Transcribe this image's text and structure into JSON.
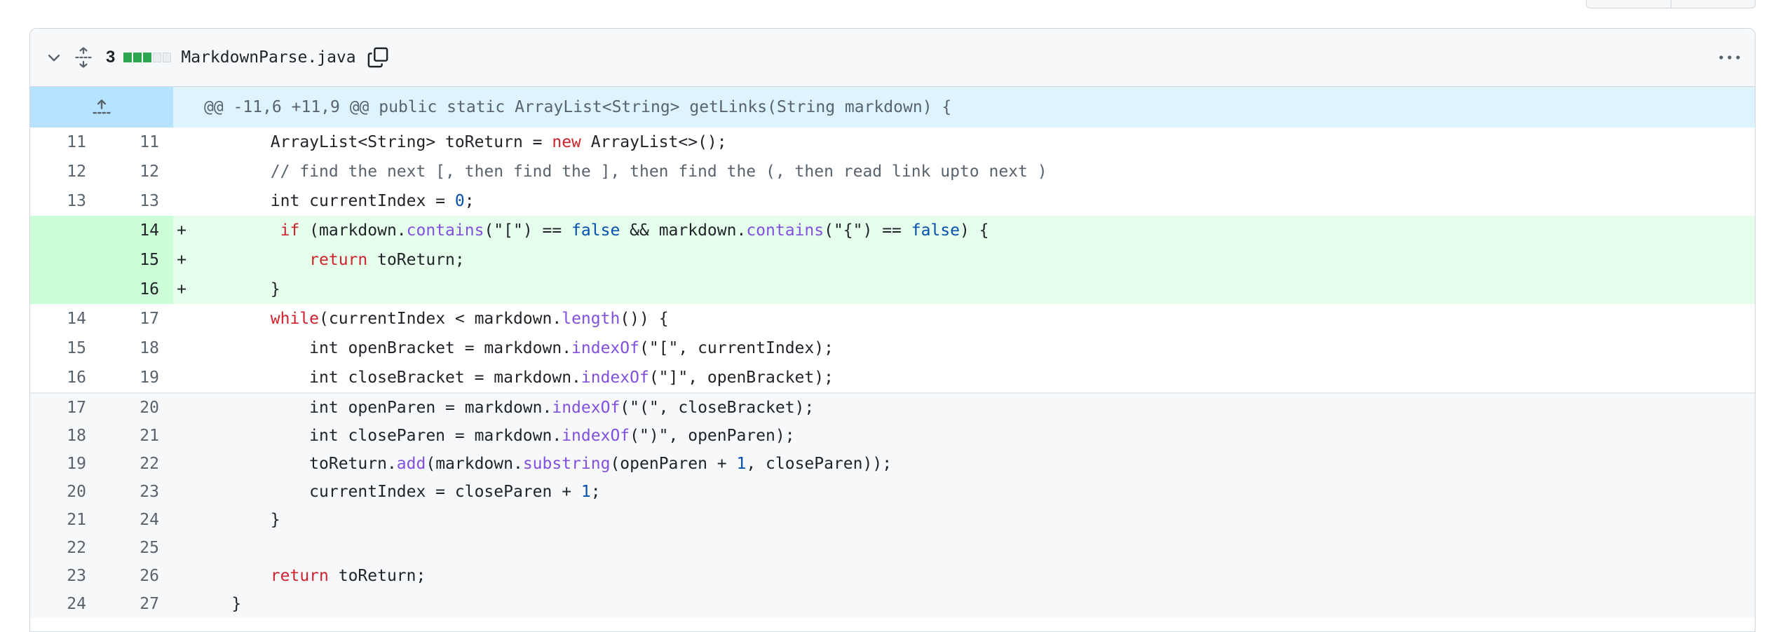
{
  "file": {
    "changes_count": "3",
    "filename": "MarkdownParse.java",
    "diffstat": [
      "add",
      "add",
      "add",
      "neutral",
      "neutral"
    ],
    "colors": {
      "add": "#2da44e",
      "neutral": "#eaeef2"
    }
  },
  "hunk": {
    "header": "@@ -11,6 +11,9 @@ public static ArrayList<String> getLinks(String markdown) {"
  },
  "lines": [
    {
      "old": "11",
      "new": "11",
      "type": "context",
      "tokens": [
        [
          "",
          "        ArrayList<String> toReturn = "
        ],
        [
          "kw",
          "new"
        ],
        [
          "",
          " ArrayList<>();"
        ]
      ]
    },
    {
      "old": "12",
      "new": "12",
      "type": "context",
      "tokens": [
        [
          "cm",
          "        // find the next [, then find the ], then find the (, then read link upto next )"
        ]
      ]
    },
    {
      "old": "13",
      "new": "13",
      "type": "context",
      "tokens": [
        [
          "",
          "        int currentIndex = "
        ],
        [
          "cst",
          "0"
        ],
        [
          "",
          ";"
        ]
      ]
    },
    {
      "old": "",
      "new": "14",
      "type": "add",
      "tokens": [
        [
          "",
          "         "
        ],
        [
          "kw",
          "if"
        ],
        [
          "",
          " (markdown."
        ],
        [
          "fn",
          "contains"
        ],
        [
          "",
          "(\"[\") == "
        ],
        [
          "cst",
          "false"
        ],
        [
          "",
          " && markdown."
        ],
        [
          "fn",
          "contains"
        ],
        [
          "",
          "(\"{\") == "
        ],
        [
          "cst",
          "false"
        ],
        [
          "",
          ") {"
        ]
      ]
    },
    {
      "old": "",
      "new": "15",
      "type": "add",
      "tokens": [
        [
          "",
          "            "
        ],
        [
          "kw",
          "return"
        ],
        [
          "",
          " toReturn;"
        ]
      ]
    },
    {
      "old": "",
      "new": "16",
      "type": "add",
      "tokens": [
        [
          "",
          "        }"
        ]
      ]
    },
    {
      "old": "14",
      "new": "17",
      "type": "context",
      "tokens": [
        [
          "",
          "        "
        ],
        [
          "kw",
          "while"
        ],
        [
          "",
          "(currentIndex < markdown."
        ],
        [
          "fn",
          "length"
        ],
        [
          "",
          "()) {"
        ]
      ]
    },
    {
      "old": "15",
      "new": "18",
      "type": "context",
      "tokens": [
        [
          "",
          "            int openBracket = markdown."
        ],
        [
          "fn",
          "indexOf"
        ],
        [
          "",
          "(\"[\", currentIndex);"
        ]
      ]
    },
    {
      "old": "16",
      "new": "19",
      "type": "context",
      "tokens": [
        [
          "",
          "            int closeBracket = markdown."
        ],
        [
          "fn",
          "indexOf"
        ],
        [
          "",
          "(\"]\", openBracket);"
        ]
      ]
    }
  ],
  "gray_lines": [
    {
      "old": "17",
      "new": "20",
      "tokens": [
        [
          "",
          "            int openParen = markdown."
        ],
        [
          "fn",
          "indexOf"
        ],
        [
          "",
          "(\"(\", closeBracket);"
        ]
      ]
    },
    {
      "old": "18",
      "new": "21",
      "tokens": [
        [
          "",
          "            int closeParen = markdown."
        ],
        [
          "fn",
          "indexOf"
        ],
        [
          "",
          "(\")\", openParen);"
        ]
      ]
    },
    {
      "old": "19",
      "new": "22",
      "tokens": [
        [
          "",
          "            toReturn."
        ],
        [
          "fn",
          "add"
        ],
        [
          "",
          "(markdown."
        ],
        [
          "fn",
          "substring"
        ],
        [
          "",
          "(openParen + "
        ],
        [
          "cst",
          "1"
        ],
        [
          "",
          ", closeParen));"
        ]
      ]
    },
    {
      "old": "20",
      "new": "23",
      "tokens": [
        [
          "",
          "            currentIndex = closeParen + "
        ],
        [
          "cst",
          "1"
        ],
        [
          "",
          ";"
        ]
      ]
    },
    {
      "old": "21",
      "new": "24",
      "tokens": [
        [
          "",
          "        }"
        ]
      ]
    },
    {
      "old": "22",
      "new": "25",
      "tokens": [
        [
          "",
          ""
        ]
      ]
    },
    {
      "old": "23",
      "new": "26",
      "tokens": [
        [
          "",
          "        "
        ],
        [
          "kw",
          "return"
        ],
        [
          "",
          " toReturn;"
        ]
      ]
    },
    {
      "old": "24",
      "new": "27",
      "tokens": [
        [
          "",
          "    }"
        ]
      ]
    }
  ]
}
